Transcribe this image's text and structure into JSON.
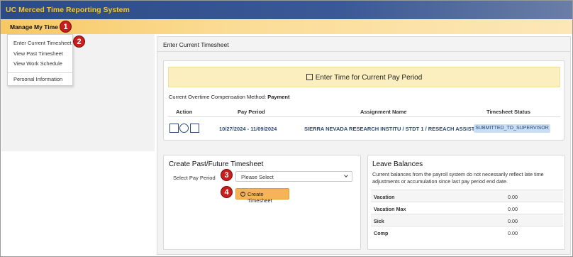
{
  "app": {
    "title": "UC Merced Time Reporting System"
  },
  "menu": {
    "label": "Manage My Time",
    "items": [
      "Enter Current Timesheet",
      "View Past Timesheet",
      "View Work Schedule",
      "Personal Information"
    ]
  },
  "callouts": [
    "1",
    "2",
    "3",
    "4"
  ],
  "main": {
    "header": "Enter Current Timesheet",
    "banner": "Enter Time for Current Pay Period",
    "overtime_label": "Current Overtime Compensation Method:",
    "overtime_value": "Payment",
    "table": {
      "headers": [
        "Action",
        "Pay Period",
        "Assignment Name",
        "Timesheet Status"
      ],
      "row": {
        "pay_start": "10/27/2024",
        "pay_sep": " - ",
        "pay_end": "11/09/2024",
        "assignment": "SIERRA NEVADA RESEARCH INSTITU / STDT 1 / RESEACH ASSIST",
        "status": "SUBMITTED_TO_SUPERVISOR"
      },
      "action_icons": [
        "calendar-edit-icon",
        "back-arrow-icon",
        "clipboard-check-icon"
      ]
    }
  },
  "create": {
    "title": "Create Past/Future Timesheet",
    "select_label": "Select Pay Period",
    "select_value": "Please Select",
    "button": "Create Timesheet"
  },
  "leave": {
    "title": "Leave Balances",
    "description": "Current balances from the payroll system do not necessarily reflect late time adjustments or accumulation since last pay period end date.",
    "rows": [
      {
        "name": "Vacation",
        "value": "0.00"
      },
      {
        "name": "Vacation Max",
        "value": "0.00"
      },
      {
        "name": "Sick",
        "value": "0.00"
      },
      {
        "name": "Comp",
        "value": "0.00"
      }
    ]
  },
  "colors": {
    "title_bar": "#2c4a86",
    "title_text": "#f5c431",
    "menu_bar": "#f7c863",
    "badge": "#c81e1e",
    "button": "#f5b458",
    "status_badge": "#c9def3",
    "link_text": "#2b4a7a"
  }
}
